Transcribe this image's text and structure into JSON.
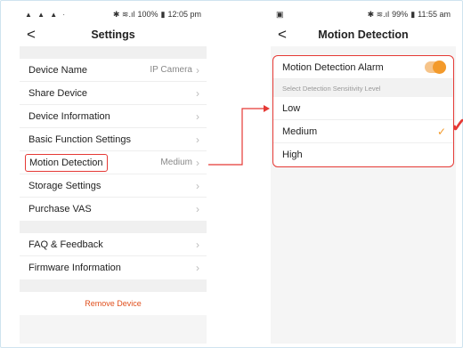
{
  "left": {
    "status": {
      "dots": "▲ ▲ ▲ ·",
      "icons": "✱ ≋.ıl",
      "battery": "100%",
      "time": "12:05 pm"
    },
    "nav": {
      "back": "<",
      "title": "Settings"
    },
    "items": [
      {
        "label": "Device Name",
        "value": "IP Camera"
      },
      {
        "label": "Share Device",
        "value": ""
      },
      {
        "label": "Device Information",
        "value": ""
      },
      {
        "label": "Basic Function Settings",
        "value": ""
      },
      {
        "label": "Motion Detection",
        "value": "Medium"
      },
      {
        "label": "Storage Settings",
        "value": ""
      },
      {
        "label": "Purchase VAS",
        "value": ""
      }
    ],
    "items2": [
      {
        "label": "FAQ & Feedback",
        "value": ""
      },
      {
        "label": "Firmware Information",
        "value": ""
      }
    ],
    "remove": "Remove Device"
  },
  "right": {
    "status": {
      "left_icon": "▣",
      "icons": "✱ ≋.ıl",
      "battery": "99%",
      "time": "11:55 am"
    },
    "nav": {
      "back": "<",
      "title": "Motion Detection"
    },
    "alarm_label": "Motion Detection Alarm",
    "section_header": "Select Detection Sensitivity Level",
    "levels": [
      {
        "label": "Low",
        "selected": false
      },
      {
        "label": "Medium",
        "selected": true
      },
      {
        "label": "High",
        "selected": false
      }
    ]
  },
  "colors": {
    "accent": "#f39a2b",
    "highlight": "#e53935",
    "remove": "#e0501e"
  }
}
